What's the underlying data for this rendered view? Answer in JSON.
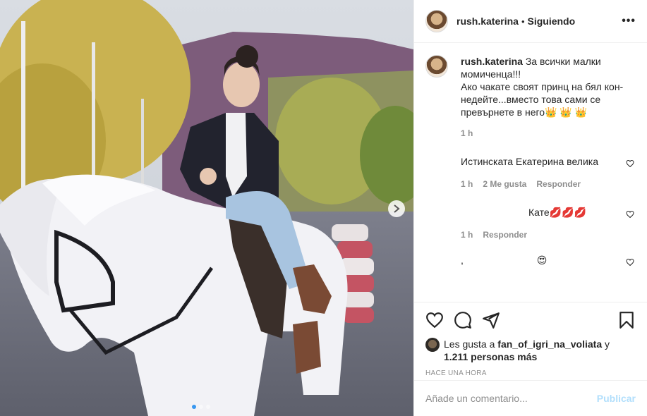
{
  "post": {
    "username": "rush.katerina",
    "separator": "•",
    "follow_status": "Siguiendo",
    "more_label": "•••",
    "caption": "За всички малки момиченца!!!\nАко чакате своят принц на бял кон- недейте...вместо това сами се превърнете в него👑 👑 👑",
    "caption_time": "1 h"
  },
  "comments": [
    {
      "text": "Истинската Екатерина велика",
      "time": "1 h",
      "likes": "2 Me gusta",
      "reply": "Responder"
    },
    {
      "text": "Кате💋💋💋",
      "time": "1 h",
      "reply": "Responder"
    },
    {
      "text": ",",
      "emoji": "😍"
    }
  ],
  "likes": {
    "prefix": "Les gusta a",
    "user": "fan_of_igri_na_voliata",
    "conj": "y",
    "others": "1.211 personas más"
  },
  "timestamp": "HACE UNA HORA",
  "comment_box": {
    "placeholder": "Añade un comentario...",
    "publish_label": "Publicar"
  },
  "carousel": {
    "count": 3,
    "active": 0
  },
  "colors": {
    "link": "#3897f0",
    "publish_disabled": "#b2dffc",
    "muted": "#8e8e8e",
    "like_red": "#ed4956"
  },
  "icons": [
    "heart-icon",
    "comment-icon",
    "share-icon",
    "bookmark-icon",
    "chevron-right-icon",
    "more-icon"
  ]
}
